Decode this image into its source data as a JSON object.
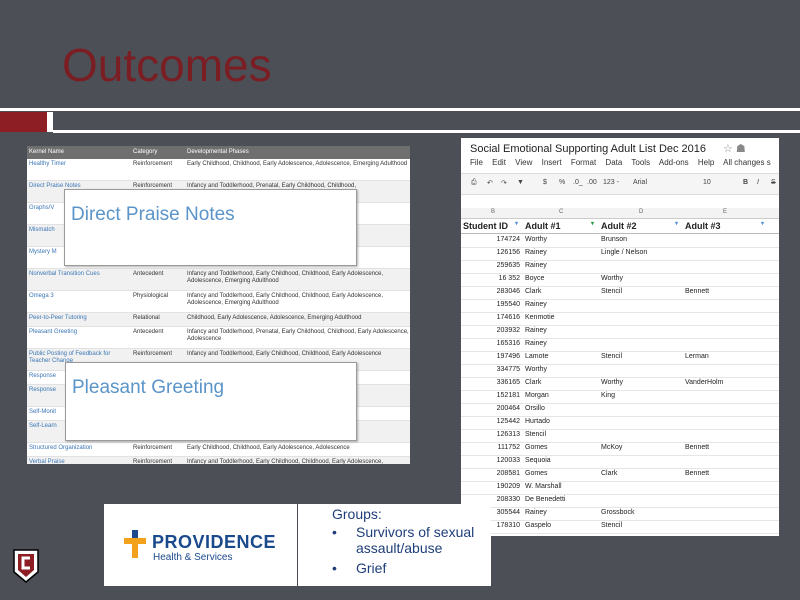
{
  "slide": {
    "title": "Outcomes"
  },
  "kernel_table": {
    "headers": [
      "Kernel Name",
      "Category",
      "Developmental Phases"
    ],
    "rows": [
      {
        "name": "Healthy Timer",
        "category": "Reinforcement",
        "phases": "Early Childhood, Childhood, Early Adolescence, Adolescence, Emerging Adulthood"
      },
      {
        "name": "Direct Praise Notes",
        "category": "Reinforcement",
        "phases": "Infancy and Toddlerhood, Prenatal, Early Childhood, Childhood,"
      },
      {
        "name": "Graphs/V",
        "category": "",
        "phases": "escence"
      },
      {
        "name": "Mismatch",
        "category": "",
        "phases": "emerging"
      },
      {
        "name": "Mystery M",
        "category": "",
        "phases": "Early"
      },
      {
        "name": "Nonverbal Transition Cues",
        "category": "Antecedent",
        "phases": "Infancy and Toddlerhood, Early Childhood, Childhood, Early Adolescence, Adolescence, Emerging Adulthood"
      },
      {
        "name": "Omega 3",
        "category": "Physiological",
        "phases": "Infancy and Toddlerhood, Early Childhood, Childhood, Early Adolescence, Adolescence, Emerging Adulthood"
      },
      {
        "name": "Peer-to-Peer Tutoring",
        "category": "Relational",
        "phases": "Childhood, Early Adolescence, Adolescence, Emerging Adulthood"
      },
      {
        "name": "Pleasant Greeting",
        "category": "Antecedent",
        "phases": "Infancy and Toddlerhood, Prenatal, Early Childhood, Childhood, Early Adolescence, Adolescence"
      },
      {
        "name": "Public Posting of Feedback for Teacher Change",
        "category": "Reinforcement",
        "phases": "Infancy and Toddlerhood, Early Childhood, Childhood, Early Adolescence"
      },
      {
        "name": "Response",
        "category": "",
        "phases": "Childhood"
      },
      {
        "name": "Response",
        "category": "",
        "phases": "Childhood"
      },
      {
        "name": "Self-Monit",
        "category": "",
        "phases": "Adulthood"
      },
      {
        "name": "Self-Learn",
        "category": "",
        "phases": "escence"
      },
      {
        "name": "Structured Organization",
        "category": "Reinforcement",
        "phases": "Early Childhood, Childhood, Early Adolescence, Adolescence"
      },
      {
        "name": "Verbal Praise",
        "category": "Reinforcement",
        "phases": "Infancy and Toddlerhood, Early Childhood, Childhood, Early Adolescence, Adolescence, Emerging Adulthood"
      }
    ],
    "callouts": [
      "Direct Praise Notes",
      "Pleasant Greeting"
    ]
  },
  "spreadsheet": {
    "title": "Social Emotional Supporting Adult List Dec 2016",
    "menu": [
      "File",
      "Edit",
      "View",
      "Insert",
      "Format",
      "Data",
      "Tools",
      "Add-ons",
      "Help",
      "All changes s"
    ],
    "toolbar": {
      "zoom": "$",
      "percent": "%",
      "dec1": ".0_",
      "dec2": ".00",
      "fmt": "123 -",
      "font": "Arial",
      "size": "10",
      "bold": "B",
      "italic": "I",
      "strike": "S"
    },
    "col_letters": [
      "B",
      "C",
      "D",
      "E"
    ],
    "headers": [
      "Student ID",
      "Adult #1",
      "Adult #2",
      "Adult #3"
    ],
    "rows": [
      [
        "174724",
        "Worthy",
        "Brunson",
        ""
      ],
      [
        "126156",
        "Rainey",
        "Lingle / Nelson",
        ""
      ],
      [
        "259635",
        "Rainey",
        "",
        ""
      ],
      [
        "16 352",
        "Boyce",
        "Worthy",
        ""
      ],
      [
        "283046",
        "Clark",
        "Stencil",
        "Bennett"
      ],
      [
        "195540",
        "Rainey",
        "",
        ""
      ],
      [
        "174616",
        "Kenmotie",
        "",
        ""
      ],
      [
        "203932",
        "Rainey",
        "",
        ""
      ],
      [
        "165316",
        "Rainey",
        "",
        ""
      ],
      [
        "197496",
        "Lamote",
        "Stencil",
        "Lerman"
      ],
      [
        "334775",
        "Worthy",
        "",
        ""
      ],
      [
        "336165",
        "Clark",
        "Worthy",
        "VanderHolm"
      ],
      [
        "152181",
        "Morgan",
        "King",
        ""
      ],
      [
        "200464",
        "Orsillo",
        "",
        ""
      ],
      [
        "125442",
        "Hurtado",
        "",
        ""
      ],
      [
        "126313",
        "Stencil",
        "",
        ""
      ],
      [
        "111752",
        "Gomes",
        "McKoy",
        "Bennett"
      ],
      [
        "120033",
        "Sequoia",
        "",
        ""
      ],
      [
        "208581",
        "Gomes",
        "Clark",
        "Bennett"
      ],
      [
        "190209",
        "W. Marshall",
        "",
        ""
      ],
      [
        "208330",
        "De Benedetti",
        "",
        ""
      ],
      [
        "305544",
        "Rainey",
        "Grossbock",
        ""
      ],
      [
        "178310",
        "Gaspelo",
        "Stencil",
        ""
      ]
    ]
  },
  "logo": {
    "name": "PROVIDENCE",
    "sub": "Health & Services"
  },
  "groups": {
    "title": "Groups:",
    "items": [
      "Survivors of sexual assault/abuse",
      "Grief"
    ],
    "bullet": "•"
  },
  "colors": {
    "background": "#4c4f55",
    "title": "#7a1e24",
    "accent_red": "#8c1e24",
    "link_blue": "#3b76b5",
    "callout_blue": "#5b94c8",
    "providence_blue": "#1b4a8c",
    "providence_gold": "#f2a21a"
  }
}
